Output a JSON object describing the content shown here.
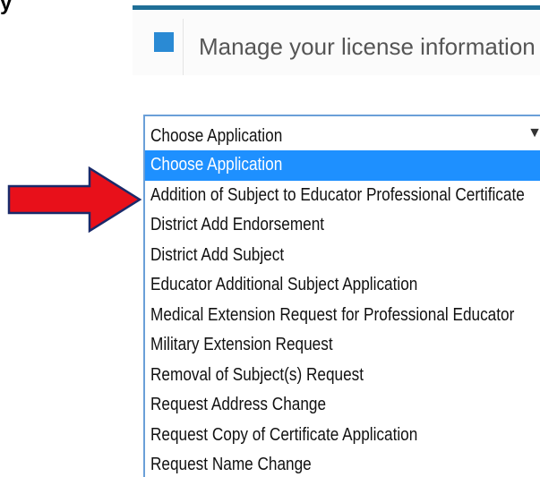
{
  "partial_glyph": "y",
  "license": {
    "title": "Manage your license information",
    "square_color": "#2a8ad4",
    "accent_color": "#1f6f97"
  },
  "select": {
    "value": "Choose Application",
    "caret": "▼",
    "options": [
      "Choose Application",
      "Addition of Subject to Educator Professional Certificate",
      "District Add Endorsement",
      "District Add Subject",
      "Educator Additional Subject Application",
      "Medical Extension Request for Professional Educator",
      "Military Extension Request",
      "Removal of Subject(s) Request",
      "Request Address Change",
      "Request Copy of Certificate Application",
      "Request Name Change"
    ],
    "highlighted_index": 0,
    "highlight_color": "#1e90ff"
  },
  "annotation": {
    "icon": "red-arrow-icon",
    "color": "#e8101a",
    "points_to_option_index": 1
  }
}
